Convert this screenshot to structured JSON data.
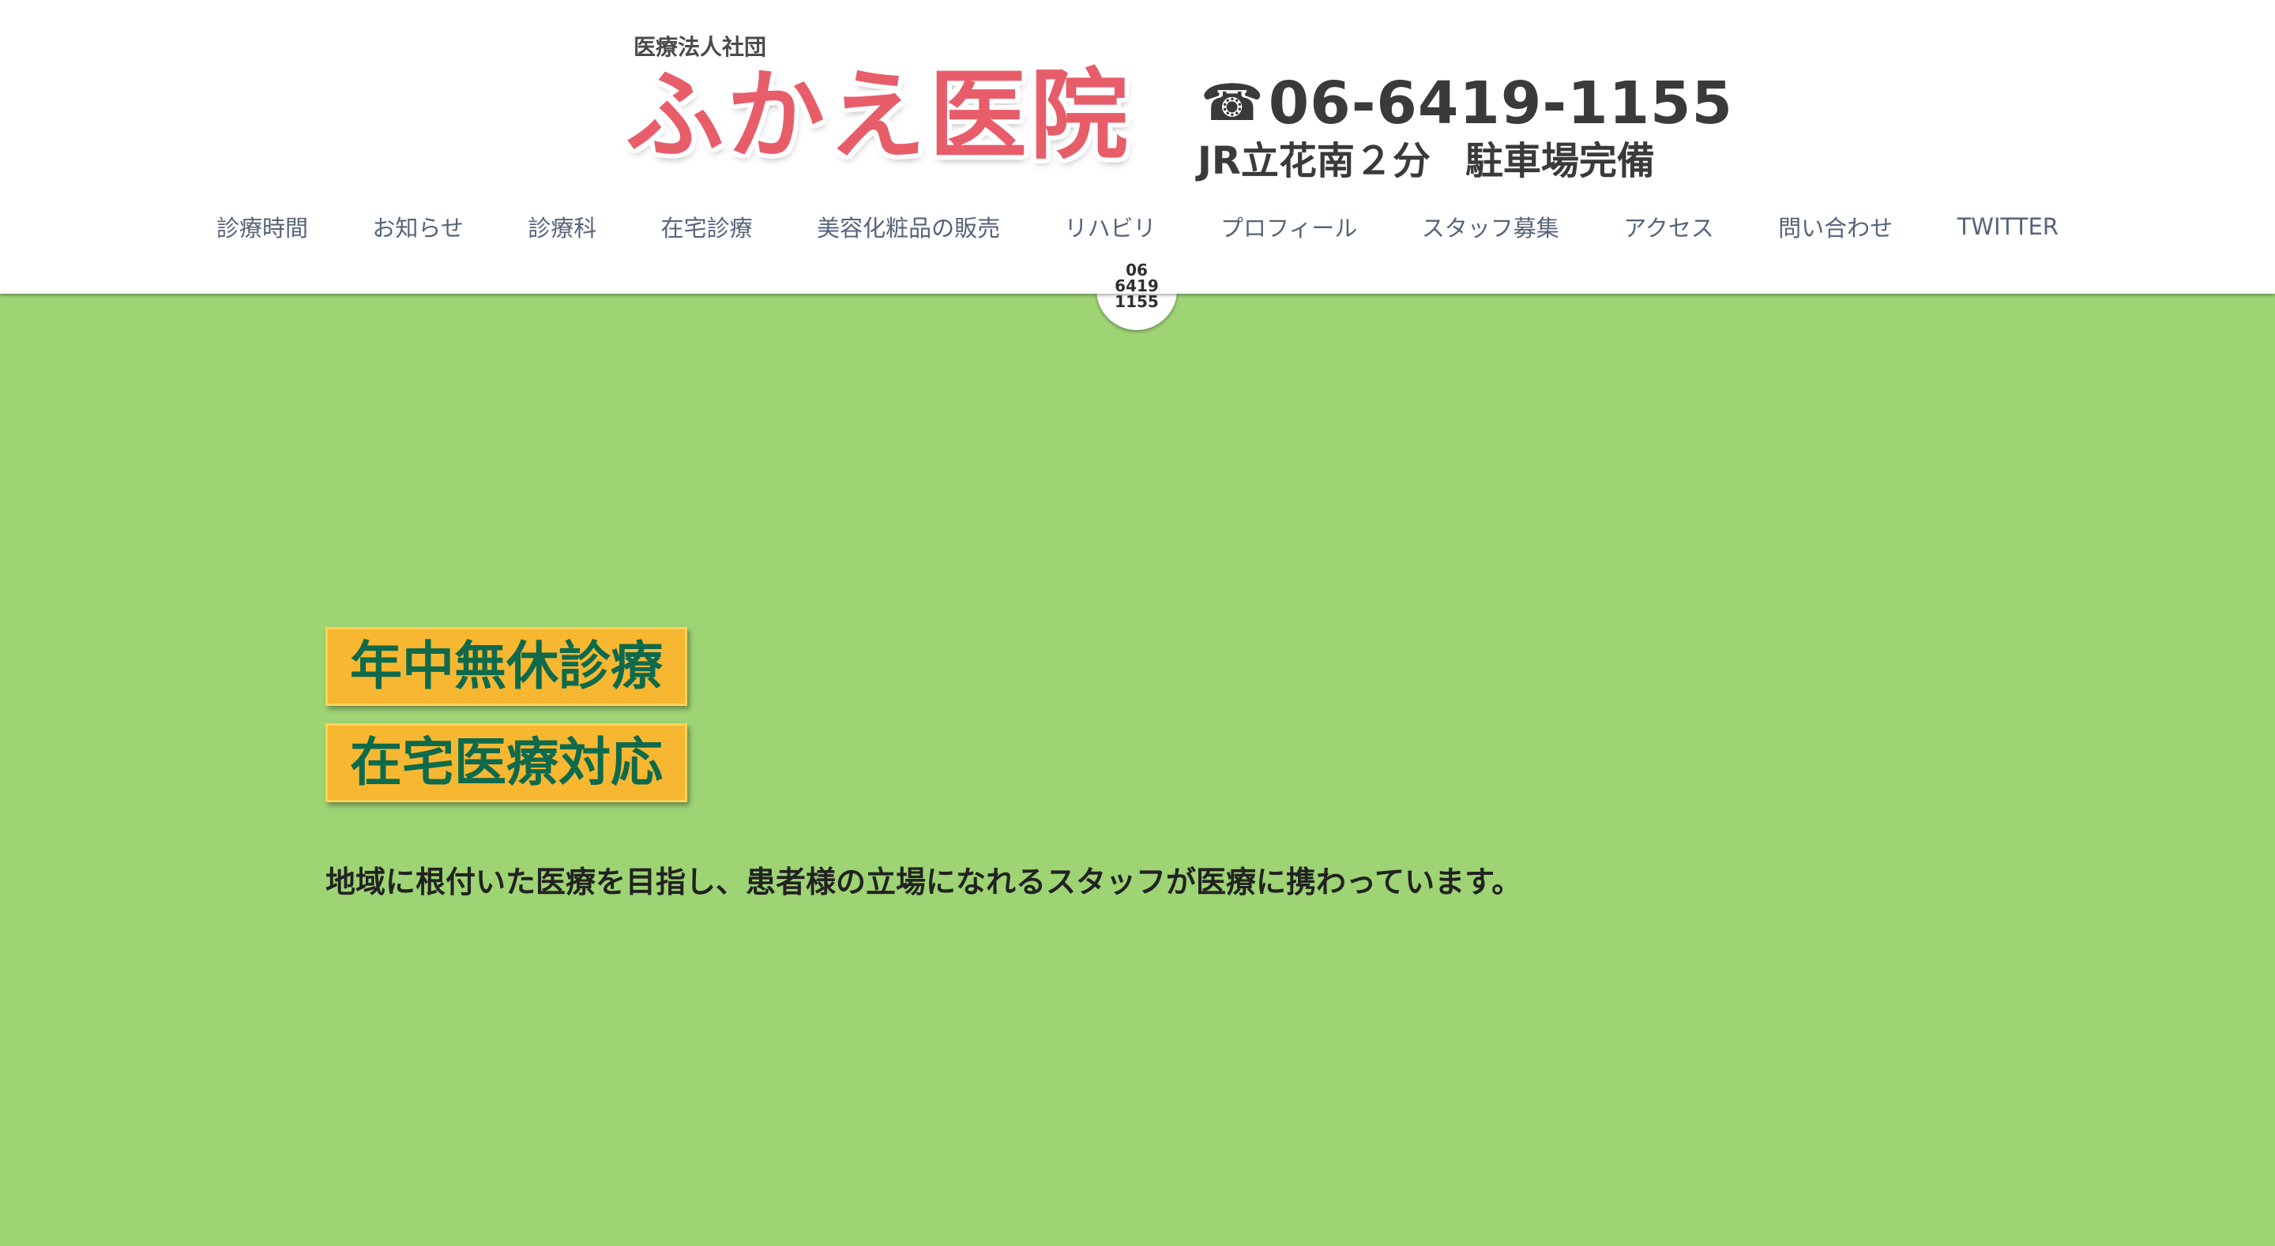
{
  "header": {
    "corporation": "医療法人社団",
    "clinic_name": "ふかえ医院",
    "phone_icon": "☎",
    "phone_number": "06-6419-1155",
    "access_station": "JR立花南２分",
    "parking": "駐車場完備"
  },
  "nav": {
    "items": [
      {
        "label": "診療時間"
      },
      {
        "label": "お知らせ"
      },
      {
        "label": "診療科"
      },
      {
        "label": "在宅診療"
      },
      {
        "label": "美容化粧品の販売"
      },
      {
        "label": "リハビリ"
      },
      {
        "label": "プロフィール"
      },
      {
        "label": "スタッフ募集"
      },
      {
        "label": "アクセス"
      },
      {
        "label": "問い合わせ"
      },
      {
        "label": "TWITTER"
      }
    ]
  },
  "tel_tab": {
    "line1": "06",
    "line2": "6419",
    "line3": "1155"
  },
  "main": {
    "badge_1": "年中無休診療",
    "badge_2": "在宅医療対応",
    "tagline": "地域に根付いた医療を目指し、患者様の立場になれるスタッフが医療に携わっています。"
  },
  "colors": {
    "background": "#9ed474",
    "logo_red": "#e85d6a",
    "badge_fill": "#f7b731",
    "badge_text": "#0d6a4d",
    "nav_text": "#56647a"
  },
  "icons": {
    "phone": "phone-icon"
  }
}
